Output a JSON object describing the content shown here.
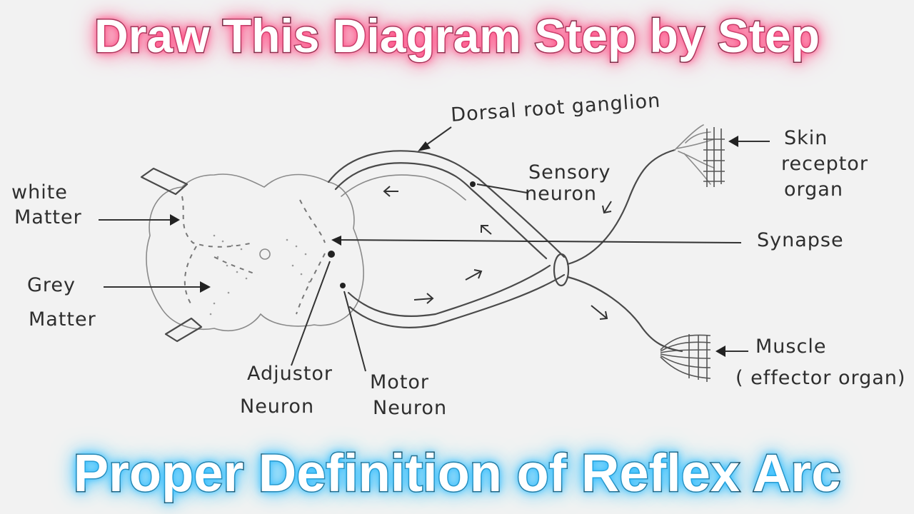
{
  "header": {
    "title": "Draw This Diagram Step by Step"
  },
  "footer": {
    "title": "Proper Definition of Reflex Arc"
  },
  "labels": {
    "white_matter_1": "white",
    "white_matter_2": "Matter",
    "grey_matter_1": "Grey",
    "grey_matter_2": "Matter",
    "dorsal_root_ganglion": "Dorsal root ganglion",
    "sensory_neuron_1": "Sensory",
    "sensory_neuron_2": "neuron",
    "skin_receptor_1": "Skin",
    "skin_receptor_2": "receptor",
    "skin_receptor_3": "organ",
    "synapse": "Synapse",
    "adjustor_1": "Adjustor",
    "adjustor_2": "Neuron",
    "motor_1": "Motor",
    "motor_2": "Neuron",
    "muscle_1": "Muscle",
    "muscle_2": "( effector organ)"
  },
  "colors": {
    "top_glow": "#ff5c8f",
    "bottom_glow": "#3cc2ff",
    "paper": "#f2f2f2",
    "pencil": "#4a4a4a"
  }
}
